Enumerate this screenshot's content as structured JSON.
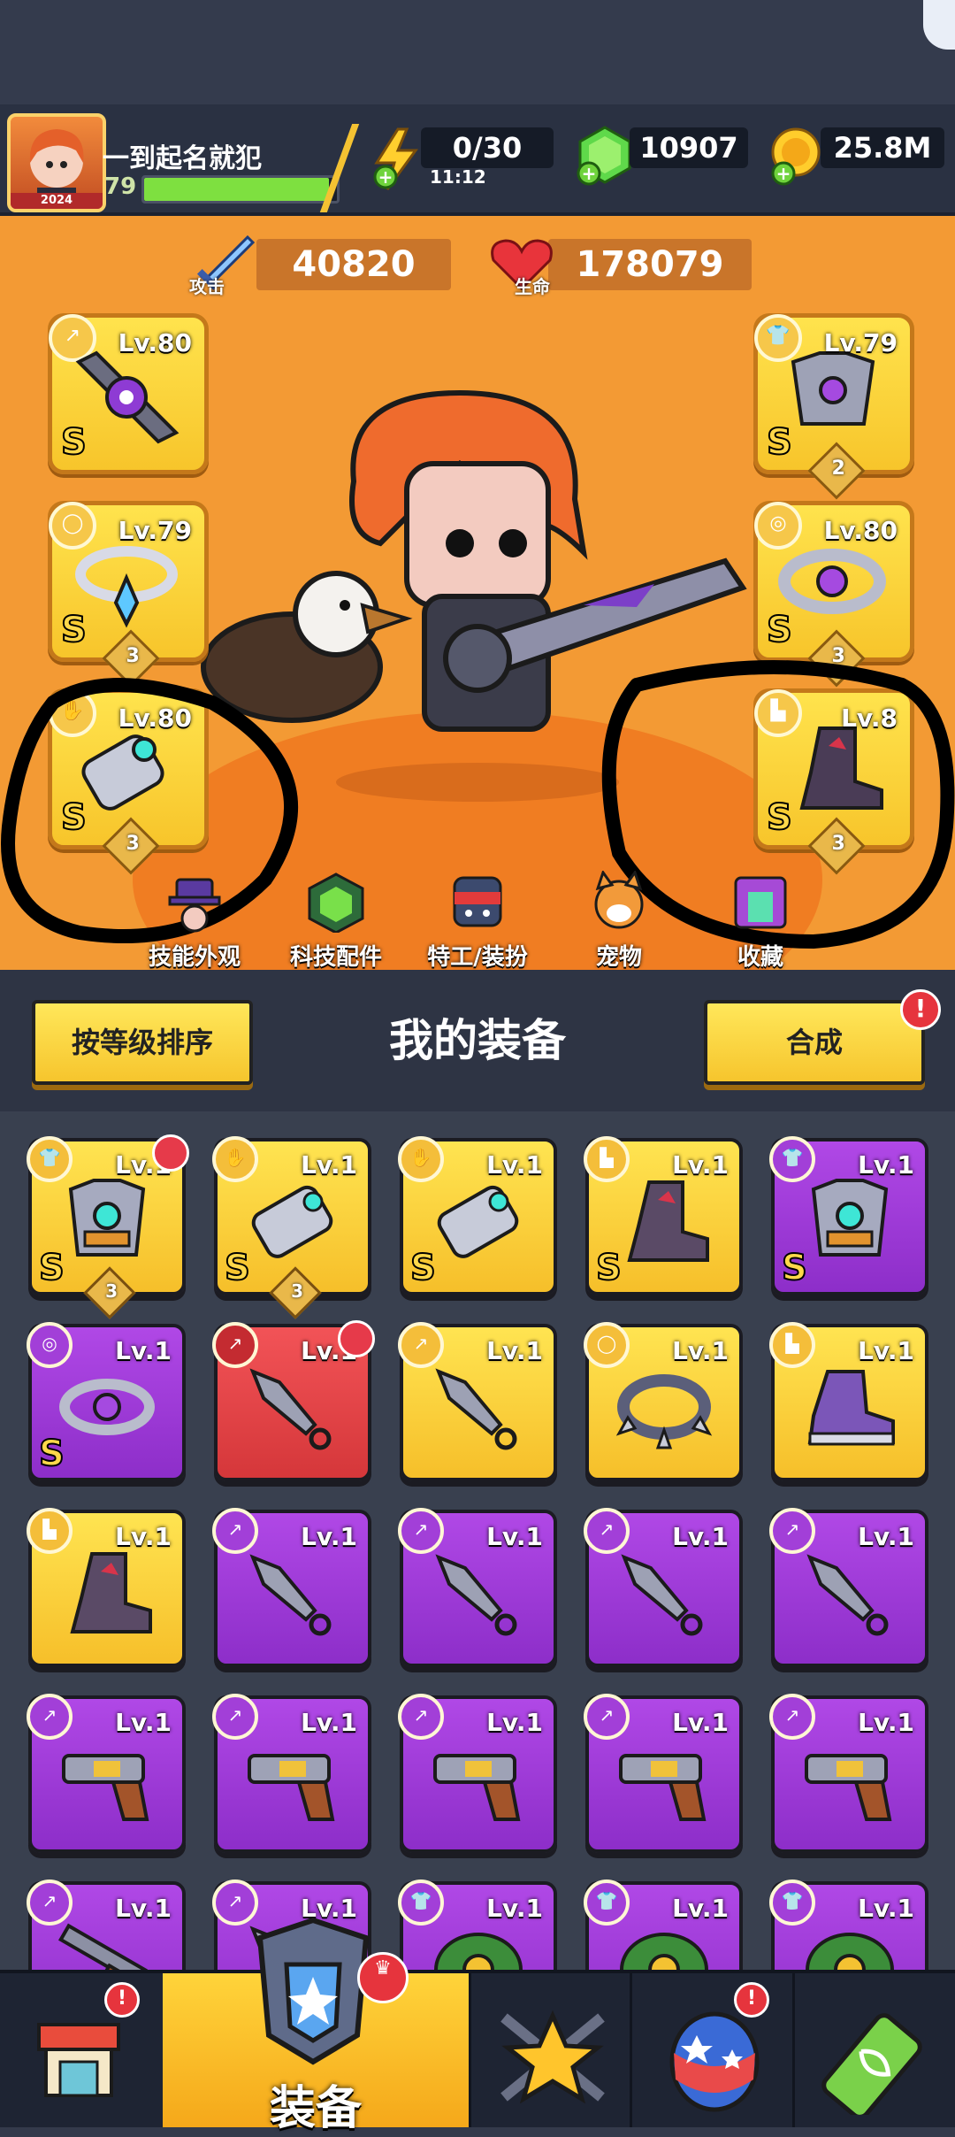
{
  "player": {
    "name": "一到起名就犯",
    "level": "79",
    "avatar_year": "2024"
  },
  "resources": {
    "energy": "0/30",
    "energy_timer": "11:12",
    "gems": "10907",
    "coins": "25.8M"
  },
  "stats": {
    "attack_label": "攻击",
    "attack_value": "40820",
    "hp_label": "生命",
    "hp_value": "178079"
  },
  "equipped": {
    "left": [
      {
        "level": "Lv.80",
        "grade": "S",
        "icon": "weapon-icon",
        "count": ""
      },
      {
        "level": "Lv.79",
        "grade": "S",
        "icon": "necklace-icon",
        "count": "3"
      },
      {
        "level": "Lv.80",
        "grade": "S",
        "icon": "glove-icon",
        "count": "3"
      }
    ],
    "right": [
      {
        "level": "Lv.79",
        "grade": "S",
        "icon": "armor-icon",
        "count": "2"
      },
      {
        "level": "Lv.80",
        "grade": "S",
        "icon": "ring-icon",
        "count": "3"
      },
      {
        "level": "Lv.8",
        "grade": "S",
        "icon": "boots-icon",
        "count": "3"
      }
    ]
  },
  "hero_nav": [
    {
      "label": "技能外观",
      "icon": "skill-skin-icon"
    },
    {
      "label": "科技配件",
      "icon": "tech-parts-icon"
    },
    {
      "label": "特工/装扮",
      "icon": "agent-costume-icon"
    },
    {
      "label": "宠物",
      "icon": "pet-icon"
    },
    {
      "label": "收藏",
      "icon": "collection-icon"
    }
  ],
  "equip_section": {
    "sort_button": "按等级排序",
    "title": "我的装备",
    "merge_button": "合成",
    "merge_badge": "!"
  },
  "inventory": [
    [
      {
        "level": "Lv.1",
        "rarity": "gold",
        "grade": "S",
        "count": "3",
        "icon": "armor-icon",
        "tag": "armor-tag-icon",
        "crown": true
      },
      {
        "level": "Lv.1",
        "rarity": "gold",
        "grade": "S",
        "count": "3",
        "icon": "glove-icon",
        "tag": "glove-tag-icon",
        "crown": false
      },
      {
        "level": "Lv.1",
        "rarity": "gold",
        "grade": "S",
        "count": "",
        "icon": "glove-icon",
        "tag": "glove-tag-icon",
        "crown": false
      },
      {
        "level": "Lv.1",
        "rarity": "gold",
        "grade": "S",
        "count": "",
        "icon": "boots-icon",
        "tag": "boots-tag-icon",
        "crown": false
      },
      {
        "level": "Lv.1",
        "rarity": "purple",
        "grade": "S",
        "count": "",
        "icon": "armor-icon",
        "tag": "armor-tag-icon",
        "crown": false
      }
    ],
    [
      {
        "level": "Lv.1",
        "rarity": "purple",
        "grade": "S",
        "count": "",
        "icon": "ring-icon",
        "tag": "ring-tag-icon",
        "crown": false
      },
      {
        "level": "Lv.1",
        "rarity": "red",
        "grade": "",
        "count": "",
        "icon": "kunai-icon",
        "tag": "weapon-tag-icon",
        "crown": true
      },
      {
        "level": "Lv.1",
        "rarity": "gold",
        "grade": "",
        "count": "",
        "icon": "kunai-icon",
        "tag": "weapon-tag-icon",
        "crown": false
      },
      {
        "level": "Lv.1",
        "rarity": "gold",
        "grade": "",
        "count": "",
        "icon": "spiked-collar-icon",
        "tag": "necklace-tag-icon",
        "crown": false
      },
      {
        "level": "Lv.1",
        "rarity": "gold",
        "grade": "",
        "count": "",
        "icon": "sneaker-icon",
        "tag": "boots-tag-icon",
        "crown": false
      }
    ],
    [
      {
        "level": "Lv.1",
        "rarity": "gold",
        "grade": "",
        "count": "",
        "icon": "boots-icon",
        "tag": "boots-tag-icon",
        "crown": false
      },
      {
        "level": "Lv.1",
        "rarity": "purple",
        "grade": "",
        "count": "",
        "icon": "kunai-icon",
        "tag": "weapon-tag-icon",
        "crown": false
      },
      {
        "level": "Lv.1",
        "rarity": "purple",
        "grade": "",
        "count": "",
        "icon": "kunai-icon",
        "tag": "weapon-tag-icon",
        "crown": false
      },
      {
        "level": "Lv.1",
        "rarity": "purple",
        "grade": "",
        "count": "",
        "icon": "kunai-icon",
        "tag": "weapon-tag-icon",
        "crown": false
      },
      {
        "level": "Lv.1",
        "rarity": "purple",
        "grade": "",
        "count": "",
        "icon": "kunai-icon",
        "tag": "weapon-tag-icon",
        "crown": false
      }
    ],
    [
      {
        "level": "Lv.1",
        "rarity": "purple",
        "grade": "",
        "count": "",
        "icon": "revolver-icon",
        "tag": "weapon-tag-icon",
        "crown": false
      },
      {
        "level": "Lv.1",
        "rarity": "purple",
        "grade": "",
        "count": "",
        "icon": "revolver-icon",
        "tag": "weapon-tag-icon",
        "crown": false
      },
      {
        "level": "Lv.1",
        "rarity": "purple",
        "grade": "",
        "count": "",
        "icon": "revolver-icon",
        "tag": "weapon-tag-icon",
        "crown": false
      },
      {
        "level": "Lv.1",
        "rarity": "purple",
        "grade": "",
        "count": "",
        "icon": "revolver-icon",
        "tag": "weapon-tag-icon",
        "crown": false
      },
      {
        "level": "Lv.1",
        "rarity": "purple",
        "grade": "",
        "count": "",
        "icon": "revolver-icon",
        "tag": "weapon-tag-icon",
        "crown": false
      }
    ],
    [
      {
        "level": "Lv.1",
        "rarity": "purple",
        "grade": "",
        "count": "",
        "icon": "shotgun-icon",
        "tag": "weapon-tag-icon",
        "crown": false
      },
      {
        "level": "Lv.1",
        "rarity": "purple",
        "grade": "",
        "count": "",
        "icon": "kunai-icon",
        "tag": "weapon-tag-icon",
        "crown": false
      },
      {
        "level": "Lv.1",
        "rarity": "purple",
        "grade": "",
        "count": "",
        "icon": "plant-armor-icon",
        "tag": "armor-tag-icon",
        "crown": false
      },
      {
        "level": "Lv.1",
        "rarity": "purple",
        "grade": "",
        "count": "",
        "icon": "plant-armor-icon",
        "tag": "armor-tag-icon",
        "crown": false
      },
      {
        "level": "Lv.1",
        "rarity": "purple",
        "grade": "",
        "count": "",
        "icon": "plant-armor-icon",
        "tag": "armor-tag-icon",
        "crown": false
      }
    ]
  ],
  "bottom_nav": [
    {
      "label": "",
      "icon": "shop-icon",
      "badge": "!"
    },
    {
      "label": "装备",
      "icon": "equipment-icon",
      "badge": ""
    },
    {
      "label": "",
      "icon": "battle-star-icon",
      "badge": ""
    },
    {
      "label": "",
      "icon": "gacha-egg-icon",
      "badge": "!"
    },
    {
      "label": "",
      "icon": "dna-capsule-icon",
      "badge": ""
    }
  ],
  "colors": {
    "hero_bg": "#f39a34",
    "gold_card": "#f7c52b",
    "purple_card": "#9a35d3",
    "red_card": "#e0464a",
    "panel_dark": "#39404f"
  }
}
